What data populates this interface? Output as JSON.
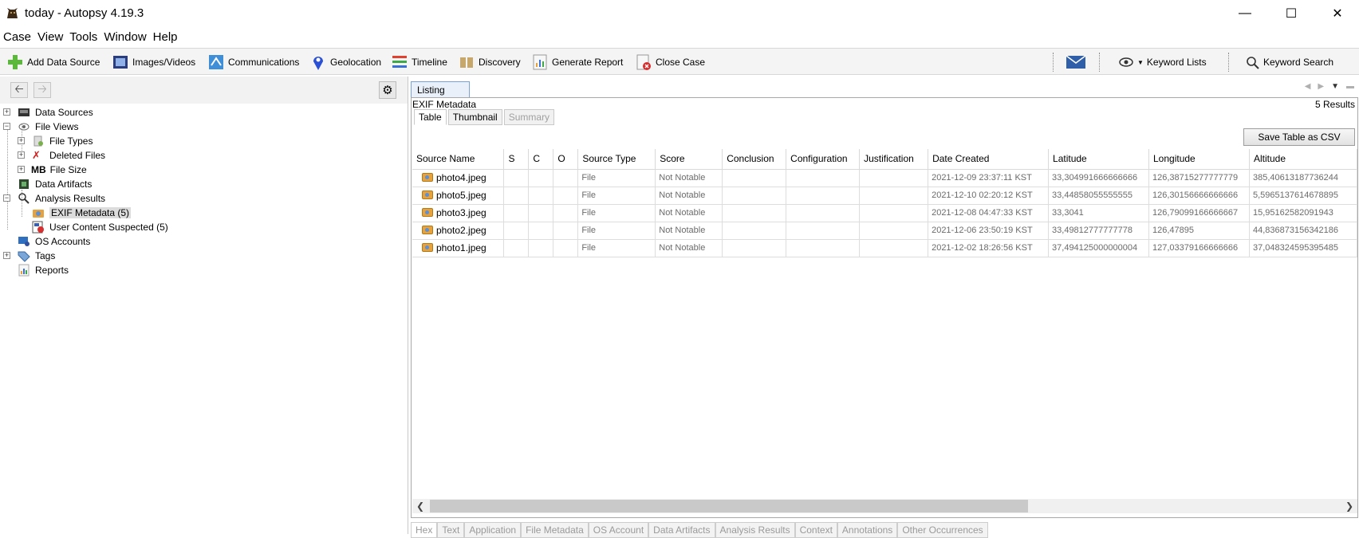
{
  "window": {
    "title": "today - Autopsy 4.19.3"
  },
  "menu": [
    "Case",
    "View",
    "Tools",
    "Window",
    "Help"
  ],
  "toolbar": {
    "add_data_source": "Add Data Source",
    "images_videos": "Images/Videos",
    "communications": "Communications",
    "geolocation": "Geolocation",
    "timeline": "Timeline",
    "discovery": "Discovery",
    "generate_report": "Generate Report",
    "close_case": "Close Case",
    "keyword_lists": "Keyword Lists",
    "keyword_search": "Keyword Search"
  },
  "tree": {
    "data_sources": "Data Sources",
    "file_views": "File Views",
    "file_types": "File Types",
    "deleted_files": "Deleted Files",
    "file_size_prefix": "MB",
    "file_size": "File Size",
    "data_artifacts": "Data Artifacts",
    "analysis_results": "Analysis Results",
    "exif_metadata": "EXIF Metadata (5)",
    "user_content_suspected": "User Content Suspected (5)",
    "os_accounts": "OS Accounts",
    "tags": "Tags",
    "reports": "Reports"
  },
  "listing": {
    "tab": "Listing",
    "header": "EXIF Metadata",
    "results": "5  Results",
    "subtabs": [
      "Table",
      "Thumbnail",
      "Summary"
    ],
    "save_csv": "Save Table as CSV",
    "columns": [
      "Source Name",
      "S",
      "C",
      "O",
      "Source Type",
      "Score",
      "Conclusion",
      "Configuration",
      "Justification",
      "Date Created",
      "Latitude",
      "Longitude",
      "Altitude"
    ],
    "rows": [
      {
        "name": "photo4.jpeg",
        "type": "File",
        "score": "Not Notable",
        "date": "2021-12-09 23:37:11 KST",
        "lat": "33,304991666666666",
        "lon": "126,38715277777779",
        "alt": "385,40613187736244"
      },
      {
        "name": "photo5.jpeg",
        "type": "File",
        "score": "Not Notable",
        "date": "2021-12-10 02:20:12 KST",
        "lat": "33,44858055555555",
        "lon": "126,30156666666666",
        "alt": "5,5965137614678895"
      },
      {
        "name": "photo3.jpeg",
        "type": "File",
        "score": "Not Notable",
        "date": "2021-12-08 04:47:33 KST",
        "lat": "33,3041",
        "lon": "126,79099166666667",
        "alt": "15,95162582091943"
      },
      {
        "name": "photo2.jpeg",
        "type": "File",
        "score": "Not Notable",
        "date": "2021-12-06 23:50:19 KST",
        "lat": "33,49812777777778",
        "lon": "126,47895",
        "alt": "44,836873156342186"
      },
      {
        "name": "photo1.jpeg",
        "type": "File",
        "score": "Not Notable",
        "date": "2021-12-02 18:26:56 KST",
        "lat": "37,494125000000004",
        "lon": "127,03379166666666",
        "alt": "37,048324595395485"
      }
    ]
  },
  "bottom_tabs": [
    "Hex",
    "Text",
    "Application",
    "File Metadata",
    "OS Account",
    "Data Artifacts",
    "Analysis Results",
    "Context",
    "Annotations",
    "Other Occurrences"
  ]
}
